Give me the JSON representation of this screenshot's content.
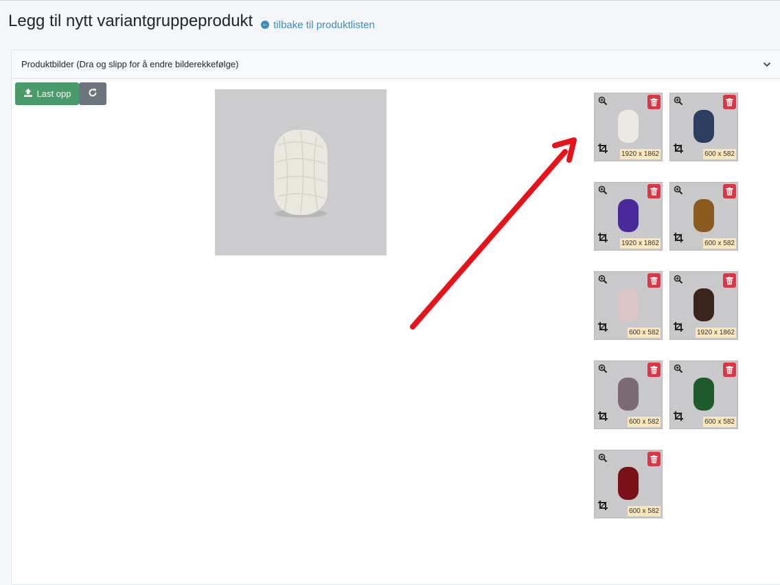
{
  "page": {
    "title": "Legg til nytt variantgruppeprodukt",
    "back_link": "tilbake til produktlisten"
  },
  "card": {
    "title": "Produktbilder (Dra og slipp for å endre bilderekkefølge)"
  },
  "toolbar": {
    "upload_label": "Last opp"
  },
  "icons": {
    "back": "arrow-left-circle-icon",
    "chevron": "chevron-down-icon",
    "upload": "upload-icon",
    "refresh": "refresh-icon",
    "zoom": "zoom-in-icon",
    "delete": "trash-icon",
    "crop": "crop-icon"
  },
  "colors": {
    "primary_link": "#3c8dbc",
    "upload_button": "#4a9b6c",
    "refresh_button": "#6c757d",
    "delete_button": "#dc3545",
    "annotation_arrow": "#e8121a"
  },
  "thumbnails": [
    {
      "dimensions": "1920 x 1862",
      "yarn_color": "#ece9e2"
    },
    {
      "dimensions": "600 x 582",
      "yarn_color": "#2c3e5f"
    },
    {
      "dimensions": "1920 x 1862",
      "yarn_color": "#4a2a9a"
    },
    {
      "dimensions": "600 x 582",
      "yarn_color": "#8a5a1f"
    },
    {
      "dimensions": "600 x 582",
      "yarn_color": "#dcc6c6"
    },
    {
      "dimensions": "1920 x 1862",
      "yarn_color": "#3b241c"
    },
    {
      "dimensions": "600 x 582",
      "yarn_color": "#7a6a72"
    },
    {
      "dimensions": "600 x 582",
      "yarn_color": "#1f5a2a"
    },
    {
      "dimensions": "600 x 582",
      "yarn_color": "#7a1018"
    }
  ]
}
